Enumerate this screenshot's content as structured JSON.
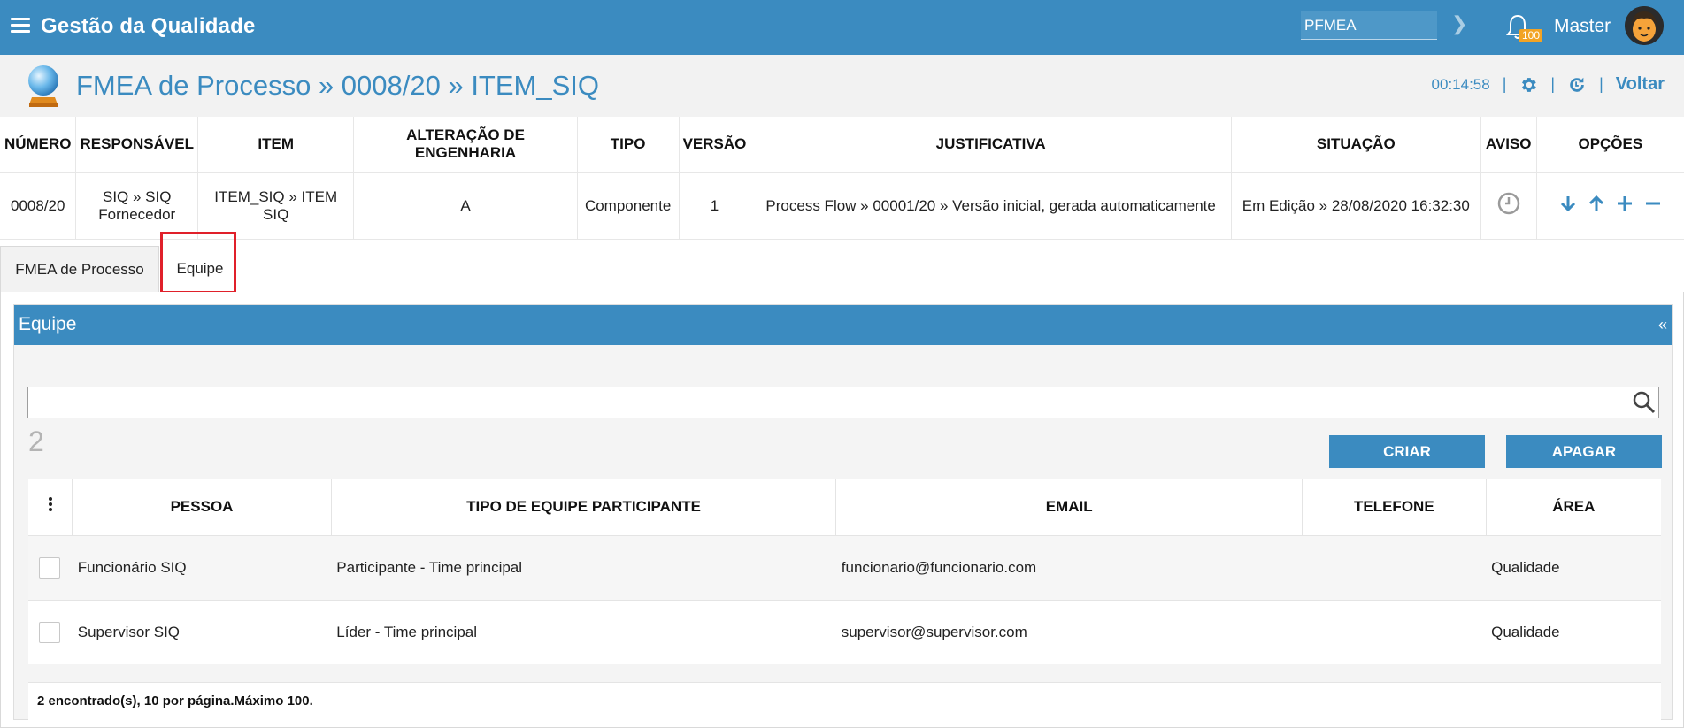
{
  "topbar": {
    "app_title": "Gestão da Qualidade",
    "module_value": "PFMEA",
    "notifications_count": "100",
    "username": "Master",
    "bg_color": "#3b8bc0"
  },
  "header": {
    "title": "FMEA de Processo » 0008/20 » ITEM_SIQ",
    "timer": "00:14:58",
    "back_label": "Voltar"
  },
  "info": {
    "headers": [
      "NÚMERO",
      "RESPONSÁVEL",
      "ITEM",
      "ALTERAÇÃO DE ENGENHARIA",
      "TIPO",
      "VERSÃO",
      "JUSTIFICATIVA",
      "SITUAÇÃO",
      "AVISO",
      "OPÇÕES"
    ],
    "row": {
      "numero": "0008/20",
      "responsavel": "SIQ » SIQ Fornecedor",
      "item": "ITEM_SIQ » ITEM SIQ",
      "alteracao": "A",
      "tipo": "Componente",
      "versao": "1",
      "justificativa": "Process Flow » 00001/20 » Versão inicial, gerada automaticamente",
      "situacao": "Em Edição » 28/08/2020 16:32:30"
    }
  },
  "tabs": [
    {
      "label": "FMEA de Processo",
      "active": false
    },
    {
      "label": "Equipe",
      "active": true
    }
  ],
  "panel": {
    "title": "Equipe",
    "collapse_glyph": "«",
    "search_value": "",
    "count": "2",
    "create_label": "CRIAR",
    "delete_label": "APAGAR"
  },
  "team_table": {
    "headers": [
      "PESSOA",
      "TIPO DE EQUIPE PARTICIPANTE",
      "EMAIL",
      "TELEFONE",
      "ÁREA"
    ],
    "rows": [
      {
        "pessoa": "Funcionário SIQ",
        "tipo": "Participante - Time principal",
        "email": "funcionario@funcionario.com",
        "telefone": "",
        "area": "Qualidade"
      },
      {
        "pessoa": "Supervisor SIQ",
        "tipo": "Líder - Time principal",
        "email": "supervisor@supervisor.com",
        "telefone": "",
        "area": "Qualidade"
      }
    ]
  },
  "footer": {
    "found_text": "2 encontrado(s), ",
    "per_page": "10",
    "per_page_text": " por página.Máximo ",
    "max": "100",
    "end": "."
  }
}
